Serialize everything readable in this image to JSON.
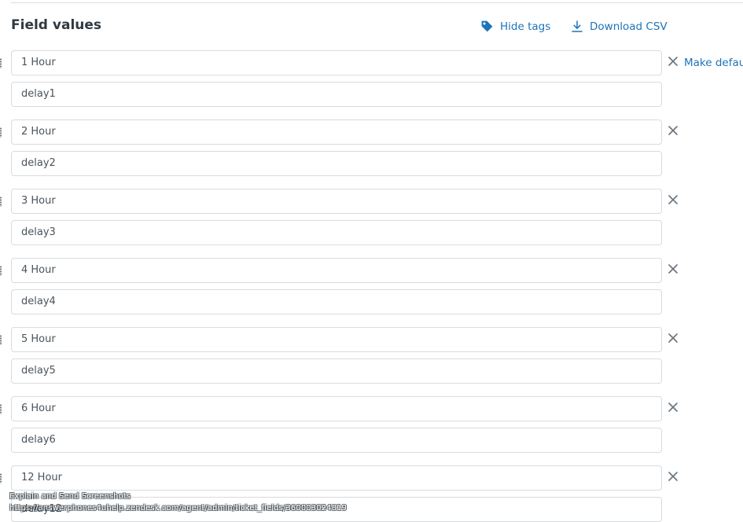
{
  "section": {
    "title": "Field values"
  },
  "actions": {
    "hide_tags": {
      "label": "Hide tags",
      "icon": "tag-icon"
    },
    "download_csv": {
      "label": "Download CSV",
      "icon": "download-icon"
    }
  },
  "field_values": [
    {
      "name": "1 Hour",
      "tag": "delay1",
      "make_default": "Make default"
    },
    {
      "name": "2 Hour",
      "tag": "delay2"
    },
    {
      "name": "3 Hour",
      "tag": "delay3"
    },
    {
      "name": "4 Hour",
      "tag": "delay4"
    },
    {
      "name": "5 Hour",
      "tag": "delay5"
    },
    {
      "name": "6 Hour",
      "tag": "delay6"
    },
    {
      "name": "12 Hour",
      "tag": "delay12"
    }
  ],
  "overlay": {
    "line1": "Explain and Send Screenshots",
    "line2": "https://answerphones4uhelp.zendesk.com/agent/admin/ticket_fields/360003024819"
  },
  "colors": {
    "accent": "#1f73b7",
    "text": "#2f3941",
    "border": "#d8dcde",
    "icon": "#68737d"
  }
}
